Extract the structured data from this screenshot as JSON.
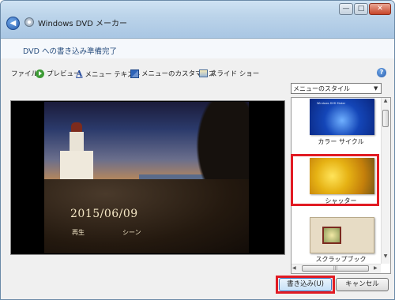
{
  "window": {
    "title": "Windows DVD メーカー",
    "min_label": "—",
    "max_label": "□",
    "close_label": "✕"
  },
  "header": {
    "page_title": "DVD への書き込み準備完了"
  },
  "toolbar": {
    "file": "ファイル",
    "preview": "プレビュー",
    "menu_text": "メニュー テキスト",
    "customize": "メニューのカスタマイズ",
    "slideshow": "スライド ショー",
    "help": "?"
  },
  "preview": {
    "date": "2015/06/09",
    "play": "再生",
    "scene": "シーン"
  },
  "style_panel": {
    "select_value": "メニューのスタイル",
    "styles": [
      {
        "label": "カラー サイクル",
        "thumb_text": "Windows DVD Maker"
      },
      {
        "label": "シャッター"
      },
      {
        "label": "スクラップブック"
      }
    ],
    "selected_index": 1,
    "hscroll_grip": "|||"
  },
  "buttons": {
    "write": "書き込み(U)",
    "cancel": "キャンセル"
  },
  "colors": {
    "highlight": "#e11b23",
    "accent": "#2a4f7f"
  }
}
